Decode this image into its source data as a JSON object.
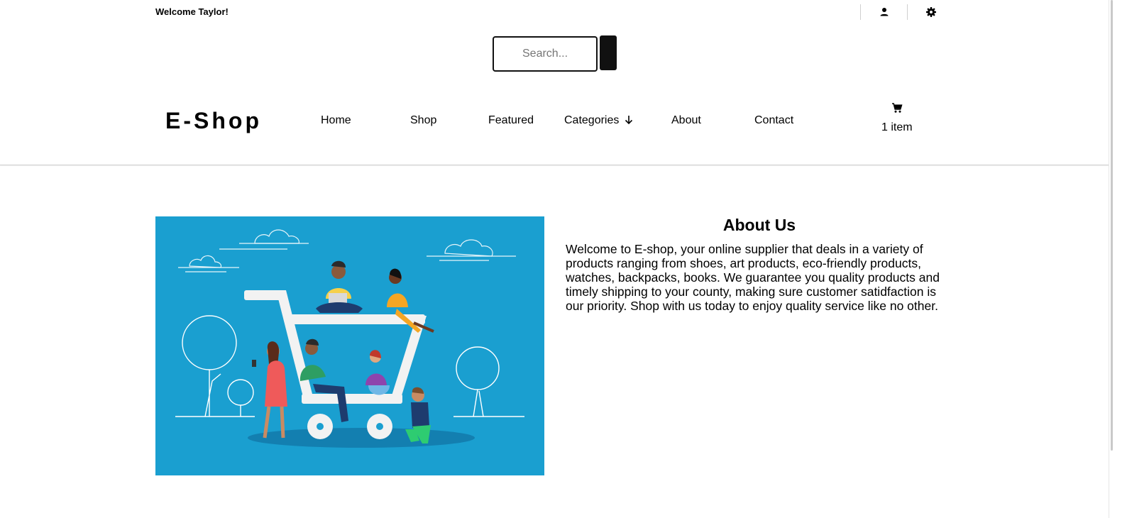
{
  "header": {
    "welcome_text": "Welcome Taylor!",
    "icons": [
      "user-icon",
      "settings-icon"
    ]
  },
  "search": {
    "placeholder": "Search...",
    "value": ""
  },
  "brand": {
    "logo_text": "E-Shop"
  },
  "nav": {
    "items": [
      {
        "label": "Home"
      },
      {
        "label": "Shop"
      },
      {
        "label": "Featured"
      },
      {
        "label": "Categories"
      },
      {
        "label": "About"
      },
      {
        "label": "Contact"
      }
    ],
    "categories_icon": "arrow-down-icon"
  },
  "cart": {
    "icon": "cart-icon",
    "count_label": "1 item"
  },
  "about": {
    "title": "About Us",
    "body": "Welcome to E-shop, your online supplier that deals in a variety of products ranging from shoes, art products, eco-friendly products, watches, backpacks, books. We guarantee you quality products and timely shipping to your county, making sure customer satidfaction is our priority. Shop with us today to enjoy quality service like no other."
  },
  "colors": {
    "hero_background": "#1a9fd0",
    "text": "#000000",
    "button": "#111111"
  }
}
